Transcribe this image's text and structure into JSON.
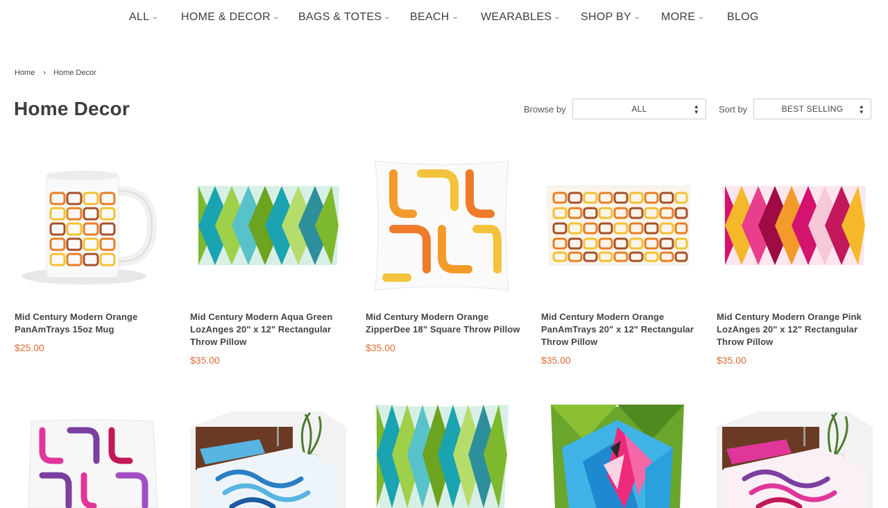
{
  "nav": {
    "items": [
      {
        "label": "ALL",
        "chevron": true
      },
      {
        "label": "HOME & DECOR",
        "chevron": true
      },
      {
        "label": "BAGS & TOTES",
        "chevron": true
      },
      {
        "label": "BEACH",
        "chevron": true
      },
      {
        "label": "WEARABLES",
        "chevron": true
      },
      {
        "label": "SHOP BY",
        "chevron": true
      },
      {
        "label": "MORE",
        "chevron": true
      },
      {
        "label": "BLOG",
        "chevron": false
      }
    ]
  },
  "breadcrumb": {
    "home": "Home",
    "separator": "›",
    "current": "Home Decor"
  },
  "page": {
    "title": "Home Decor"
  },
  "filters": {
    "browse_label": "Browse by",
    "browse_value": "ALL",
    "sort_label": "Sort by",
    "sort_value": "BEST SELLING"
  },
  "colors": {
    "price": "#e06b35",
    "text": "#444444"
  },
  "products": [
    {
      "name": "Mid Century Modern Orange PanAmTrays 15oz Mug",
      "price": "$25.00",
      "image": "mug-orange-panamtrays"
    },
    {
      "name": "Mid Century Modern Aqua Green LozAnges 20\" x 12\" Rectangular Throw Pillow",
      "price": "$35.00",
      "image": "pillow-rect-aqua-lozanges"
    },
    {
      "name": "Mid Century Modern Orange ZipperDee 18\" Square Throw Pillow",
      "price": "$35.00",
      "image": "pillow-square-orange-zipperdee"
    },
    {
      "name": "Mid Century Modern Orange PanAmTrays 20\" x 12\" Rectangular Throw Pillow",
      "price": "$35.00",
      "image": "pillow-rect-orange-panamtrays"
    },
    {
      "name": "Mid Century Modern Orange Pink LozAnges 20\" x 12\" Rectangular Throw Pillow",
      "price": "$35.00",
      "image": "pillow-rect-pink-lozanges"
    },
    {
      "name": "",
      "price": "",
      "image": "pillow-purple-zipperdee"
    },
    {
      "name": "",
      "price": "",
      "image": "bed-blue-duvet"
    },
    {
      "name": "",
      "price": "",
      "image": "pillow-square-aqua-lozanges"
    },
    {
      "name": "",
      "price": "",
      "image": "pillow-square-flamingo"
    },
    {
      "name": "",
      "price": "",
      "image": "bed-pink-duvet"
    }
  ]
}
